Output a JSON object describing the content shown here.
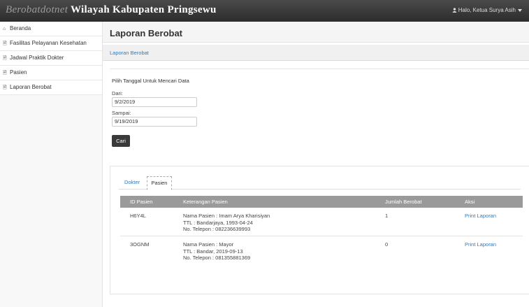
{
  "header": {
    "brand_italic": "Berobatdotnet",
    "brand_rest": " Wilayah Kabupaten Pringsewu",
    "user_greeting": "Halo, Ketua Surya Asih"
  },
  "sidebar": {
    "items": [
      {
        "icon": "home-icon",
        "label": "Beranda"
      },
      {
        "icon": "document-icon",
        "label": "Fasilitas Pelayanan Kesehatan"
      },
      {
        "icon": "document-icon",
        "label": "Jadwal Praktik Dokter"
      },
      {
        "icon": "document-icon",
        "label": "Pasien"
      },
      {
        "icon": "document-icon",
        "label": "Laporan Berobat"
      }
    ]
  },
  "main": {
    "page_title": "Laporan Berobat",
    "breadcrumb": "Laporan Berobat",
    "form": {
      "title": "Pilih Tanggal Untuk Mencari Data",
      "from_label": "Dari:",
      "from_value": "9/2/2019",
      "to_label": "Sampai:",
      "to_value": "9/19/2019",
      "search_button": "Cari"
    },
    "tabs": [
      {
        "label": "Dokter"
      },
      {
        "label": "Pasien"
      }
    ],
    "table": {
      "headers": [
        "ID Pasien",
        "Keterangan Pasien",
        "Jumlah Berobat",
        "Aksi"
      ],
      "rows": [
        {
          "id": "H6Y4L",
          "name": "Nama Pasien : Imam Arya Kharisiyan",
          "ttl": "TTL : Bandarjaya, 1993-04-24",
          "phone": "No. Telepon : 082236639993",
          "count": "1",
          "action": "Print Laporan"
        },
        {
          "id": "3OGNM",
          "name": "Nama Pasien : Mayor",
          "ttl": "TTL : Bandar, 2019-09-13",
          "phone": "No. Telepon : 081355881369",
          "count": "0",
          "action": "Print Laporan"
        }
      ]
    }
  }
}
